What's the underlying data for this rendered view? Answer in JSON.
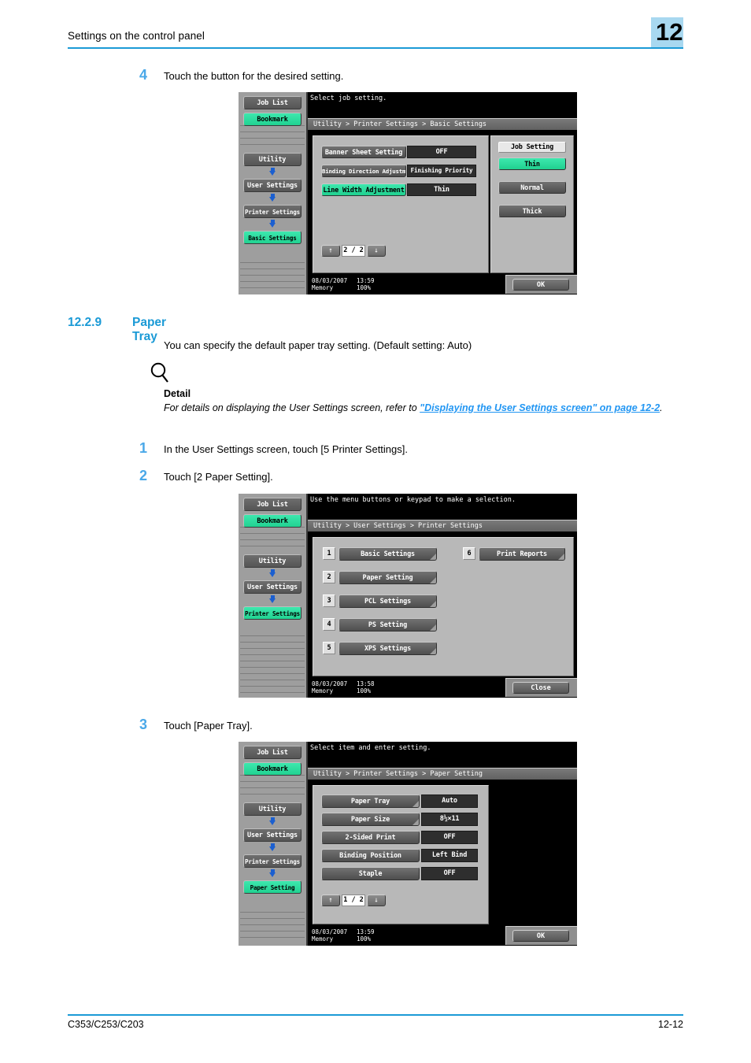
{
  "header": {
    "title": "Settings on the control panel",
    "chapter": "12"
  },
  "footer": {
    "model": "C353/C253/C203",
    "page": "12-12"
  },
  "steps": {
    "step4": {
      "num": "4",
      "text": "Touch the button for the desired setting."
    },
    "step1": {
      "num": "1",
      "text": "In the User Settings screen, touch [5 Printer Settings]."
    },
    "step2": {
      "num": "2",
      "text": "Touch [2 Paper Setting]."
    },
    "step3": {
      "num": "3",
      "text": "Touch [Paper Tray]."
    }
  },
  "section": {
    "number": "12.2.9",
    "title": "Paper Tray",
    "intro": "You can specify the default paper tray setting. (Default setting: Auto)"
  },
  "detail": {
    "icon": "magnifier-icon",
    "title": "Detail",
    "text_before": "For details on displaying the User Settings screen, refer to ",
    "link": "\"Displaying the User Settings screen\" on page 12-2",
    "text_after": "."
  },
  "panel1": {
    "prompt": "Select job setting.",
    "breadcrumb": "Utility > Printer Settings > Basic Settings",
    "rail": {
      "job_list": "Job List",
      "bookmark": "Bookmark",
      "utility": "Utility",
      "user_settings": "User Settings",
      "printer_settings": "Printer Settings",
      "basic_settings": "Basic Settings"
    },
    "rows": [
      {
        "label": "Banner Sheet Setting",
        "value": "OFF",
        "selected": false
      },
      {
        "label": "Binding Direction Adjustment",
        "value": "Finishing Priority",
        "selected": false
      },
      {
        "label": "Line Width Adjustment",
        "value": "Thin",
        "selected": true
      }
    ],
    "side": {
      "title": "Job Setting",
      "options": [
        {
          "label": "Thin",
          "selected": true
        },
        {
          "label": "Normal",
          "selected": false
        },
        {
          "label": "Thick",
          "selected": false
        }
      ]
    },
    "pager": {
      "up": "↑",
      "page": "2 / 2",
      "down": "↓"
    },
    "status": {
      "date": "08/03/2007",
      "time": "13:59",
      "memory_label": "Memory",
      "memory_value": "100%"
    },
    "ok": "OK"
  },
  "panel2": {
    "prompt": "Use the menu buttons or keypad to make a selection.",
    "breadcrumb": "Utility > User Settings > Printer Settings",
    "rail": {
      "job_list": "Job List",
      "bookmark": "Bookmark",
      "utility": "Utility",
      "user_settings": "User Settings",
      "printer_settings": "Printer Settings"
    },
    "menu_left": [
      {
        "index": "1",
        "label": "Basic Settings"
      },
      {
        "index": "2",
        "label": "Paper Setting"
      },
      {
        "index": "3",
        "label": "PCL Settings"
      },
      {
        "index": "4",
        "label": "PS Setting"
      },
      {
        "index": "5",
        "label": "XPS Settings"
      }
    ],
    "menu_right": [
      {
        "index": "6",
        "label": "Print Reports"
      }
    ],
    "status": {
      "date": "08/03/2007",
      "time": "13:58",
      "memory_label": "Memory",
      "memory_value": "100%"
    },
    "close": "Close"
  },
  "panel3": {
    "prompt": "Select item and enter setting.",
    "breadcrumb": "Utility > Printer Settings > Paper Setting",
    "rail": {
      "job_list": "Job List",
      "bookmark": "Bookmark",
      "utility": "Utility",
      "user_settings": "User Settings",
      "printer_settings": "Printer Settings",
      "paper_setting": "Paper Setting"
    },
    "rows": [
      {
        "label": "Paper Tray",
        "value": "Auto",
        "corner": true
      },
      {
        "label": "Paper Size",
        "value": "8½×11",
        "corner": true
      },
      {
        "label": "2-Sided Print",
        "value": "OFF",
        "corner": false
      },
      {
        "label": "Binding Position",
        "value": "Left Bind",
        "corner": false
      },
      {
        "label": "Staple",
        "value": "OFF",
        "corner": false
      }
    ],
    "pager": {
      "up": "↑",
      "page": "1 / 2",
      "down": "↓"
    },
    "status": {
      "date": "08/03/2007",
      "time": "13:59",
      "memory_label": "Memory",
      "memory_value": "100%"
    },
    "ok": "OK"
  }
}
